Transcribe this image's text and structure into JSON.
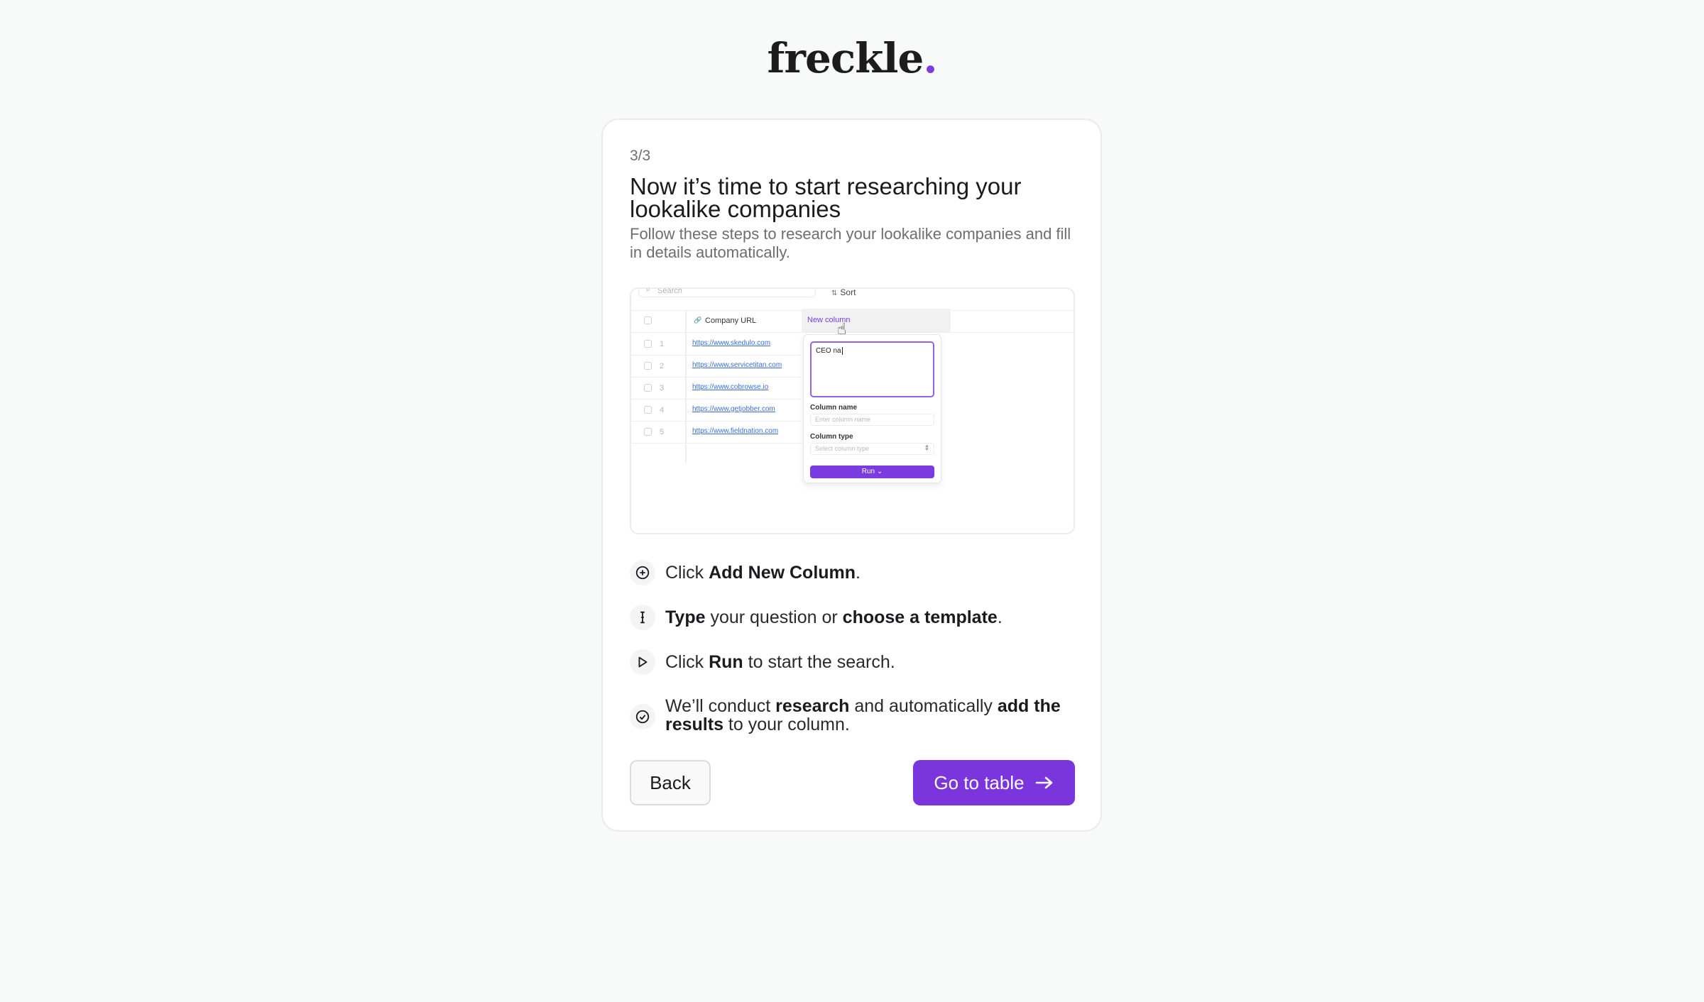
{
  "brand": {
    "name": "freckle",
    "dot": ".",
    "accent": "#7a35dc"
  },
  "onboarding": {
    "step_counter": "3/3",
    "title": "Now it’s time to start researching your lookalike companies",
    "subtitle": "Follow these steps to research your lookalike companies and fill in details automatically."
  },
  "illustration": {
    "search_placeholder": "Search",
    "sort_label": "Sort",
    "column_header": "Company URL",
    "new_column_label": "New column",
    "rows": [
      {
        "num": "1",
        "url": "https://www.skedulo.com"
      },
      {
        "num": "2",
        "url": "https://www.servicetitan.com"
      },
      {
        "num": "3",
        "url": "https://www.cobrowse.io"
      },
      {
        "num": "4",
        "url": "https://www.getjobber.com"
      },
      {
        "num": "5",
        "url": "https://www.fieldnation.com"
      }
    ],
    "prompt_text": "CEO na",
    "column_name_label": "Column name",
    "column_name_placeholder": "Enter column name",
    "column_type_label": "Column type",
    "column_type_placeholder": "Select column type",
    "run_label": "Run"
  },
  "steps": [
    {
      "icon": "plus-circle-icon",
      "parts": [
        {
          "t": "Click ",
          "b": false
        },
        {
          "t": "Add New Column",
          "b": true
        },
        {
          "t": ".",
          "b": false
        }
      ]
    },
    {
      "icon": "text-cursor-icon",
      "parts": [
        {
          "t": "Type",
          "b": true
        },
        {
          "t": " your question or ",
          "b": false
        },
        {
          "t": "choose a template",
          "b": true
        },
        {
          "t": ".",
          "b": false
        }
      ]
    },
    {
      "icon": "play-icon",
      "parts": [
        {
          "t": "Click ",
          "b": false
        },
        {
          "t": "Run",
          "b": true
        },
        {
          "t": " to start the search.",
          "b": false
        }
      ]
    },
    {
      "icon": "check-circle-icon",
      "parts": [
        {
          "t": "We’ll conduct ",
          "b": false
        },
        {
          "t": "research",
          "b": true
        },
        {
          "t": " and automatically ",
          "b": false
        },
        {
          "t": "add the results",
          "b": true
        },
        {
          "t": " to your column.",
          "b": false
        }
      ]
    }
  ],
  "actions": {
    "back_label": "Back",
    "go_label": "Go to table"
  }
}
